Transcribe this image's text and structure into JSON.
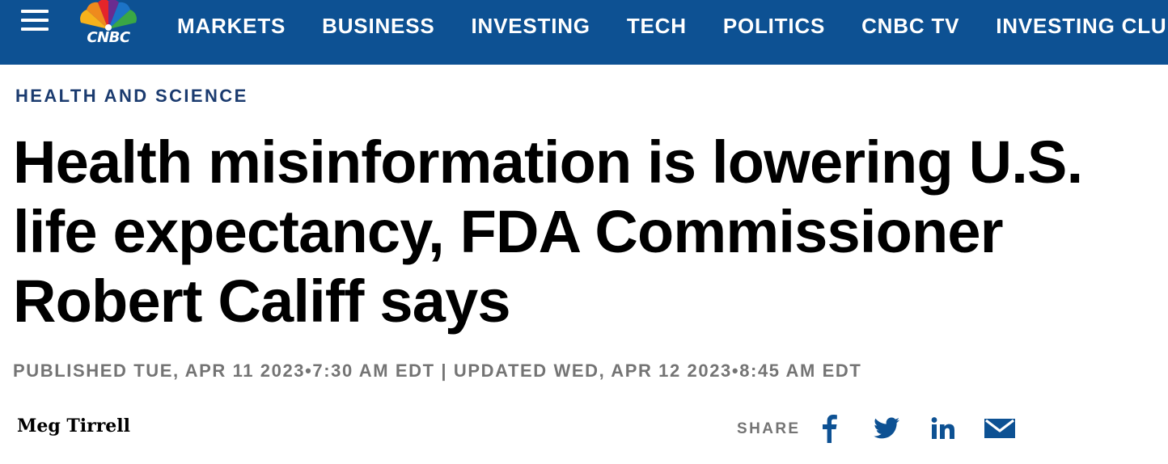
{
  "header": {
    "brand": "CNBC",
    "nav": [
      "MARKETS",
      "BUSINESS",
      "INVESTING",
      "TECH",
      "POLITICS",
      "CNBC TV",
      "INVESTING CLUB"
    ],
    "colors": {
      "bar": "#0d5193",
      "text": "#ffffff"
    }
  },
  "article": {
    "section": "HEALTH AND SCIENCE",
    "headline": "Health misinformation is lowering U.S. life expectancy, FDA Commissioner Robert Califf says",
    "timestamps": "PUBLISHED TUE, APR 11 2023•7:30 AM EDT | UPDATED WED, APR 12 2023•8:45 AM EDT",
    "author": "Meg Tirrell"
  },
  "share": {
    "label": "SHARE",
    "icons": [
      "facebook-icon",
      "twitter-icon",
      "linkedin-icon",
      "email-icon"
    ],
    "color": "#0d5193"
  }
}
